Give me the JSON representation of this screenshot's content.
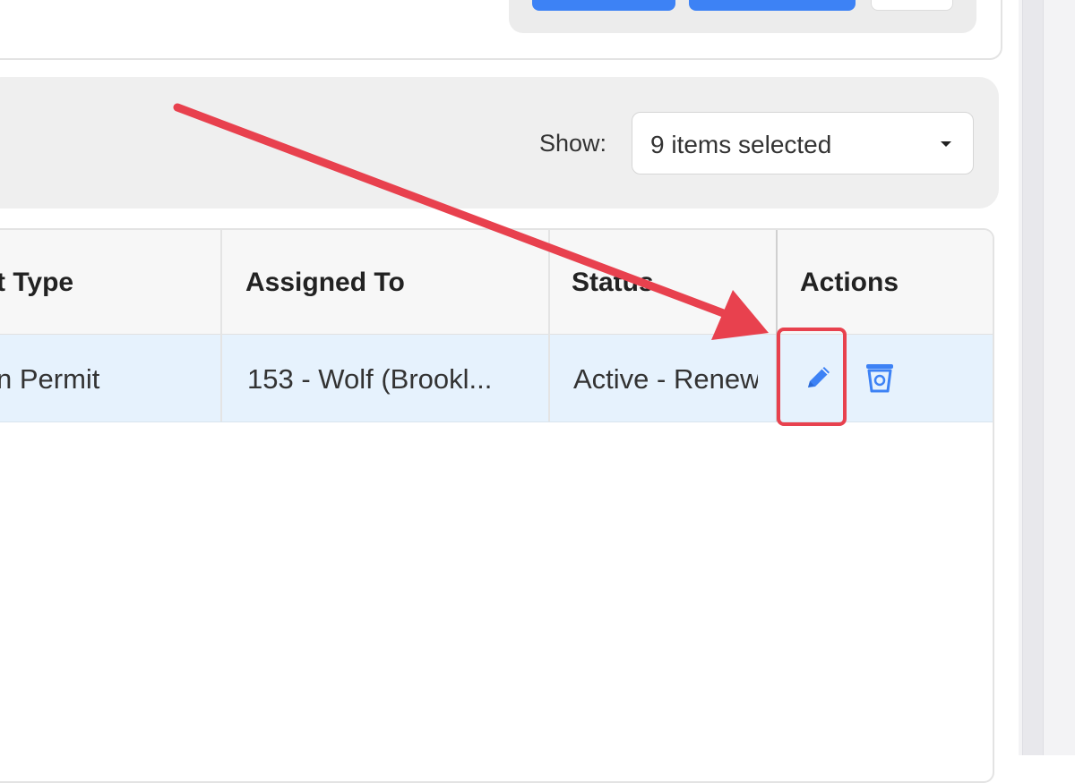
{
  "filter": {
    "show_label": "Show:",
    "select_value": "9 items selected"
  },
  "table": {
    "headers": [
      "t Type",
      "Assigned To",
      "Status",
      "Actions"
    ],
    "rows": [
      {
        "type": "n Permit",
        "assigned_to": "153 - Wolf (Brookl...",
        "status": "Active - Renewal"
      }
    ]
  },
  "icons": {
    "edit": "pencil-icon",
    "delete": "trash-icon",
    "dropdown": "caret-down-icon"
  },
  "colors": {
    "accent": "#3d82f5",
    "row_highlight": "#e6f2fd",
    "annotation_red": "#e8414e"
  }
}
